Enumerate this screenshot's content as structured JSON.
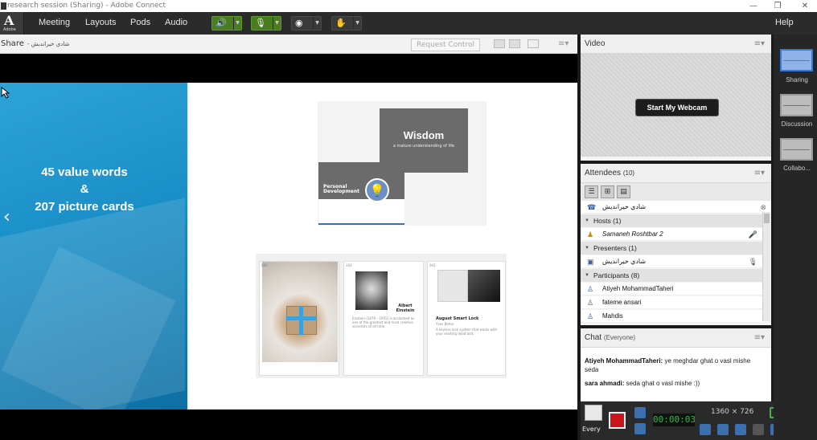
{
  "window": {
    "title": "research session (Sharing) - Adobe Connect",
    "controls": [
      "—",
      "❐",
      "✕"
    ]
  },
  "logo": {
    "text": "A",
    "sub": "Adobe"
  },
  "menubar": {
    "items": [
      "Meeting",
      "Layouts",
      "Pods",
      "Audio"
    ],
    "help": "Help"
  },
  "share_pod": {
    "title": "Share",
    "subtitle": "- شادي خيرانديش",
    "request_control": "Request Control",
    "menu_glyph": "≡▾",
    "slide": {
      "headline_1": "45 value words",
      "headline_2": "&",
      "headline_3": "207 picture cards",
      "wisdom_title": "Wisdom",
      "wisdom_sub": "a mature understanding of life",
      "pd_line1": "Personal",
      "pd_line2": "Development",
      "bulb_glyph": "💡",
      "cards": [
        {
          "num": "089",
          "title": "",
          "text": ""
        },
        {
          "num": "102",
          "title": "Albert Einstein",
          "text": "Einstein (1879 – 1955) is acclaimed as one of the greatest and most creative scientists of all time."
        },
        {
          "num": "043",
          "title": "August Smart Lock",
          "subtitle": "Yves Behar",
          "text": "A keyless lock system that works with your existing dead bolt."
        }
      ]
    }
  },
  "video_pod": {
    "title": "Video",
    "start_webcam": "Start My Webcam",
    "menu_glyph": "≡▾"
  },
  "attendees_pod": {
    "title": "Attendees",
    "count": "(10)",
    "menu_glyph": "≡▾",
    "me_name": "شادي خيرانديش",
    "groups": [
      {
        "label": "Hosts (1)",
        "members": [
          "Samaneh Roshtbar 2"
        ]
      },
      {
        "label": "Presenters (1)",
        "members": [
          "شادي خيرانديش"
        ]
      },
      {
        "label": "Participants (8)",
        "members": [
          "Atiyeh MohammadTaheri",
          "fateme ansari",
          "Mahdis"
        ]
      }
    ]
  },
  "chat_pod": {
    "title": "Chat",
    "scope": "(Everyone)",
    "menu_glyph": "≡▾",
    "messages": [
      {
        "from": "Atiyeh MohammadTaheri:",
        "text": "ye meghdar ghat o vasl mishe seda"
      },
      {
        "from": "sara ahmadi:",
        "text": "seda ghat o vasl mishe :))"
      }
    ],
    "everyone_label": "Every"
  },
  "recorder": {
    "timer": "00:00:03",
    "resolution": "1360 × 726"
  },
  "layouts_bar": {
    "items": [
      "Sharing",
      "Discussion",
      "Collabo..."
    ]
  },
  "colors": {
    "accent": "#3a7ad6",
    "record": "#c8141c",
    "timer": "#18c83a",
    "slide_blue": "#1a8fc7"
  }
}
